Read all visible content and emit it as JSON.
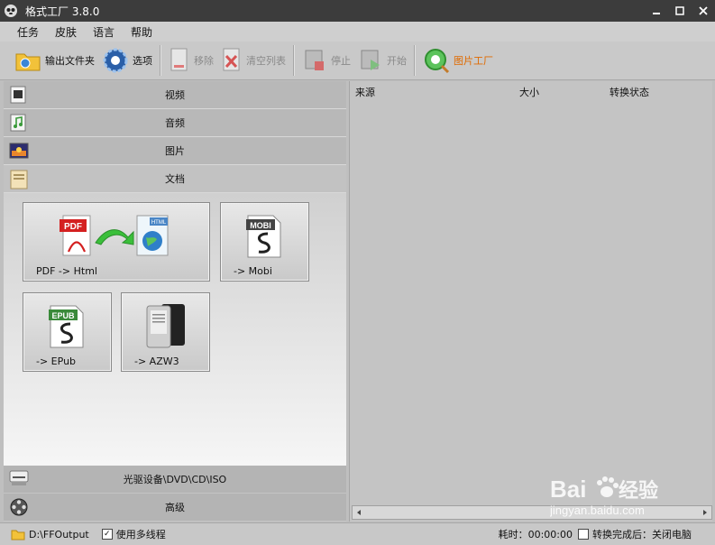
{
  "window": {
    "title": "格式工厂 3.8.0"
  },
  "menu": [
    "任务",
    "皮肤",
    "语言",
    "帮助"
  ],
  "toolbar": {
    "output_folder": "输出文件夹",
    "options": "选项",
    "remove": "移除",
    "clear_list": "清空列表",
    "stop": "停止",
    "start": "开始",
    "picture_factory": "图片工厂"
  },
  "categories": {
    "video": "视频",
    "audio": "音频",
    "image": "图片",
    "document": "文档",
    "rom": "光驱设备\\DVD\\CD\\ISO",
    "advanced": "高级"
  },
  "doc_tiles": {
    "pdf_html": "PDF -> Html",
    "mobi": "-> Mobi",
    "epub": "-> EPub",
    "azw3": "-> AZW3",
    "pdf_badge": "PDF",
    "html_badge": "HTML",
    "mobi_badge": "MOBI",
    "epub_badge": "EPUB"
  },
  "list_headers": {
    "source": "来源",
    "size": "大小",
    "status": "转换状态"
  },
  "status": {
    "output_path": "D:\\FFOutput",
    "multithread": "使用多线程",
    "elapsed": "耗时：00:00:00",
    "after_done": "转换完成后：关闭电脑"
  },
  "watermark": {
    "logo": "Bai du 经验",
    "url": "jingyan.baidu.com"
  },
  "colors": {
    "titlebar": "#3c3c3c",
    "picture_factory": "#e06a00",
    "pdf_red": "#d42020",
    "arrow_green": "#3bbf3b"
  }
}
